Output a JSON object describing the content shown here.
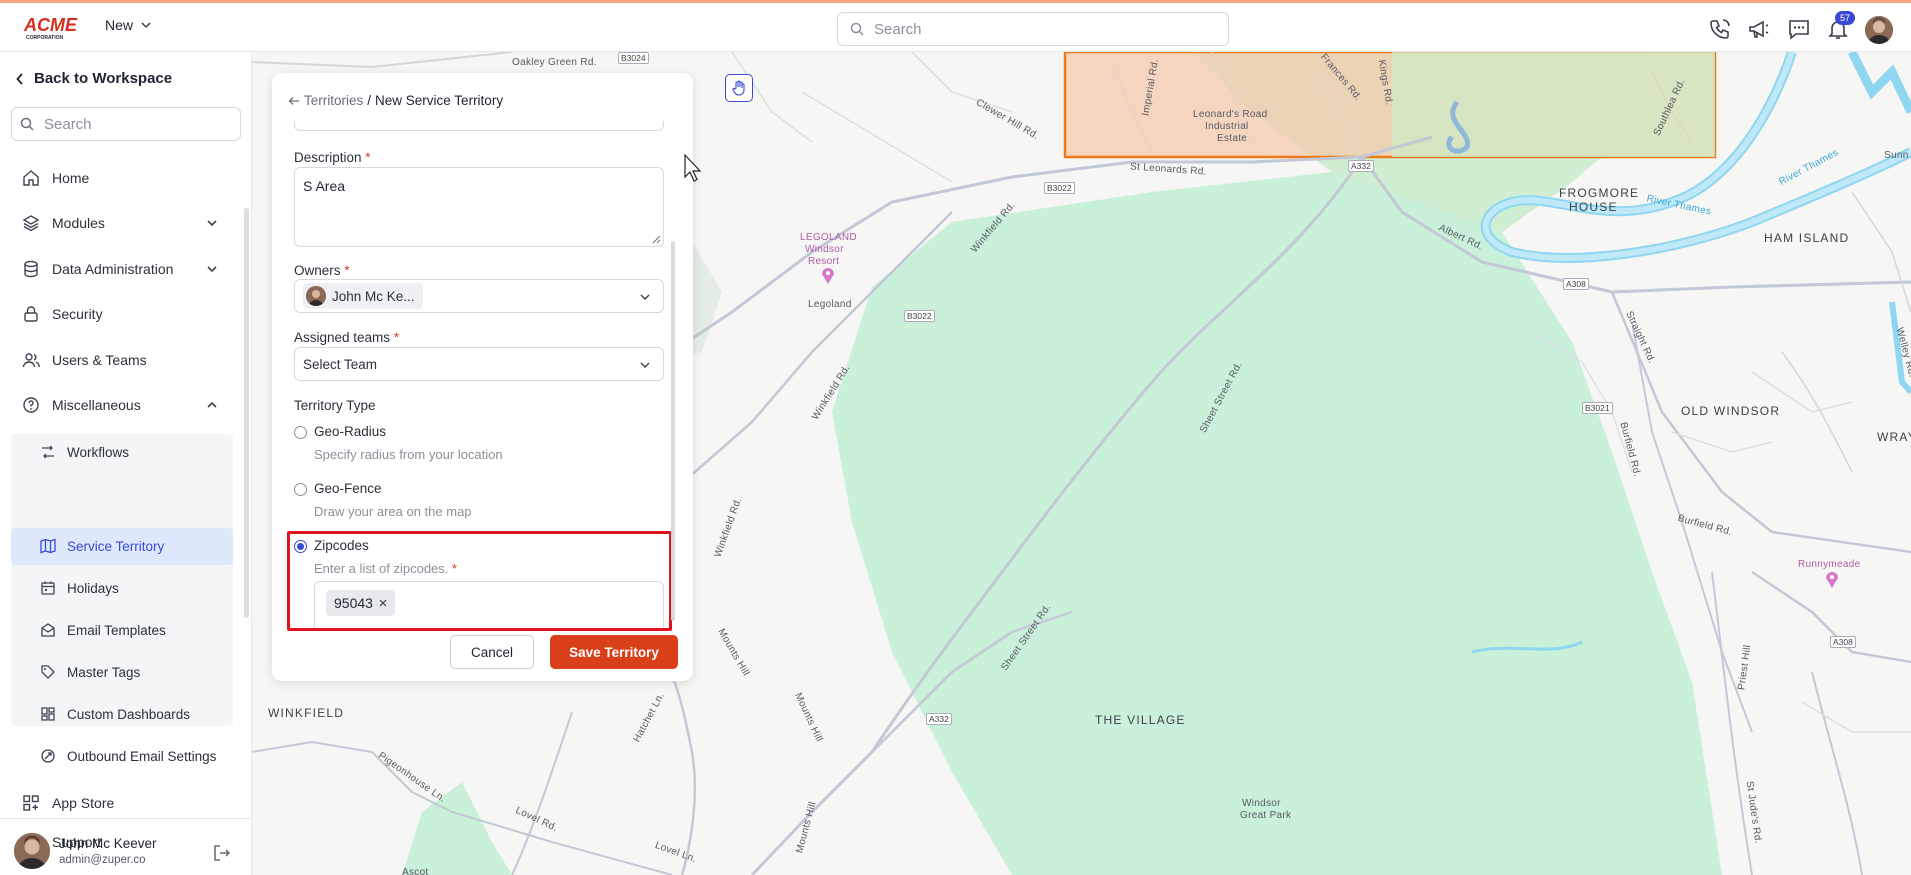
{
  "app": {
    "logo_alt": "ACME CORPORATION",
    "new_label": "New",
    "search_placeholder": "Search",
    "notification_count": "57"
  },
  "sidebar": {
    "back_label": "Back to Workspace",
    "search_placeholder": "Search",
    "items": [
      {
        "label": "Home",
        "icon": "home-icon"
      },
      {
        "label": "Modules",
        "icon": "layers-icon"
      },
      {
        "label": "Data Administration",
        "icon": "database-icon"
      },
      {
        "label": "Security",
        "icon": "lock-icon"
      },
      {
        "label": "Users & Teams",
        "icon": "users-icon"
      },
      {
        "label": "Miscellaneous",
        "icon": "help-circle-icon"
      }
    ],
    "sub_items": [
      {
        "label": "Workflows",
        "icon": "workflow-icon"
      },
      {
        "label": "Service Territory",
        "icon": "map-icon",
        "active": true
      },
      {
        "label": "Holidays",
        "icon": "calendar-icon"
      },
      {
        "label": "Email Templates",
        "icon": "mail-icon"
      },
      {
        "label": "Master Tags",
        "icon": "tag-icon"
      },
      {
        "label": "Custom Dashboards",
        "icon": "dashboard-icon"
      },
      {
        "label": "Outbound Email Settings",
        "icon": "settings-icon"
      }
    ],
    "bottom_items": [
      {
        "label": "App Store",
        "icon": "apps-icon"
      },
      {
        "label": "Support",
        "icon": "help-icon"
      }
    ],
    "user": {
      "name": "John Mc Keever",
      "email": "admin@zuper.co"
    }
  },
  "form": {
    "breadcrumb_parent": "Territories",
    "breadcrumb_sep": "/",
    "breadcrumb_current": "New Service Territory",
    "description_label": "Description",
    "description_value": "S Area",
    "owners_label": "Owners",
    "owner_chip": "John Mc Ke...",
    "teams_label": "Assigned teams",
    "teams_placeholder": "Select Team",
    "territory_type_label": "Territory Type",
    "options": [
      {
        "label": "Geo-Radius",
        "desc": "Specify radius from your location",
        "selected": false
      },
      {
        "label": "Geo-Fence",
        "desc": "Draw your area on the map",
        "selected": false
      },
      {
        "label": "Zipcodes",
        "desc": "Enter a list of zipcodes.",
        "selected": true
      }
    ],
    "zipcodes": [
      "95043"
    ],
    "cancel_label": "Cancel",
    "save_label": "Save Territory",
    "required_mark": "*"
  },
  "map": {
    "labels": [
      "FROGMORE",
      "HOUSE",
      "HAM ISLAND",
      "OLD WINDSOR",
      "WRAY",
      "THE VILLAGE",
      "WINKFIELD",
      "LEGOLAND",
      "Windsor",
      "Resort",
      "Legoland",
      "Leonard's Road",
      "Industrial",
      "Estate",
      "Runnymeade",
      "Windsor",
      "Great Park",
      "Ascot",
      "River Thames",
      "River Thames",
      "Sunn"
    ],
    "roads": [
      "Clewer Hill Rd.",
      "St Leonards Rd.",
      "Winkfield Rd.",
      "Winkfield Rd.",
      "Winkfield Rd.",
      "Sheet Street Rd.",
      "Sheet Street Rd.",
      "Albert Rd.",
      "Straight Rd.",
      "Burfield Rd.",
      "Burfield Rd.",
      "Mounts Hill",
      "Mounts Hill",
      "Mounts Hill",
      "Hatchet Ln.",
      "Pigeonhouse Ln.",
      "Lovel Rd.",
      "Lovel Ln.",
      "Priest Hill",
      "St Jude's Rd.",
      "Imperial Rd.",
      "Frances Rd.",
      "Kings Rd.",
      "Southlea Rd.",
      "Welley Rd.",
      "Oakley Green Rd."
    ],
    "road_tags": [
      "B3024",
      "B3022",
      "B3022",
      "A332",
      "A308",
      "B3021",
      "A308",
      "A332"
    ]
  }
}
